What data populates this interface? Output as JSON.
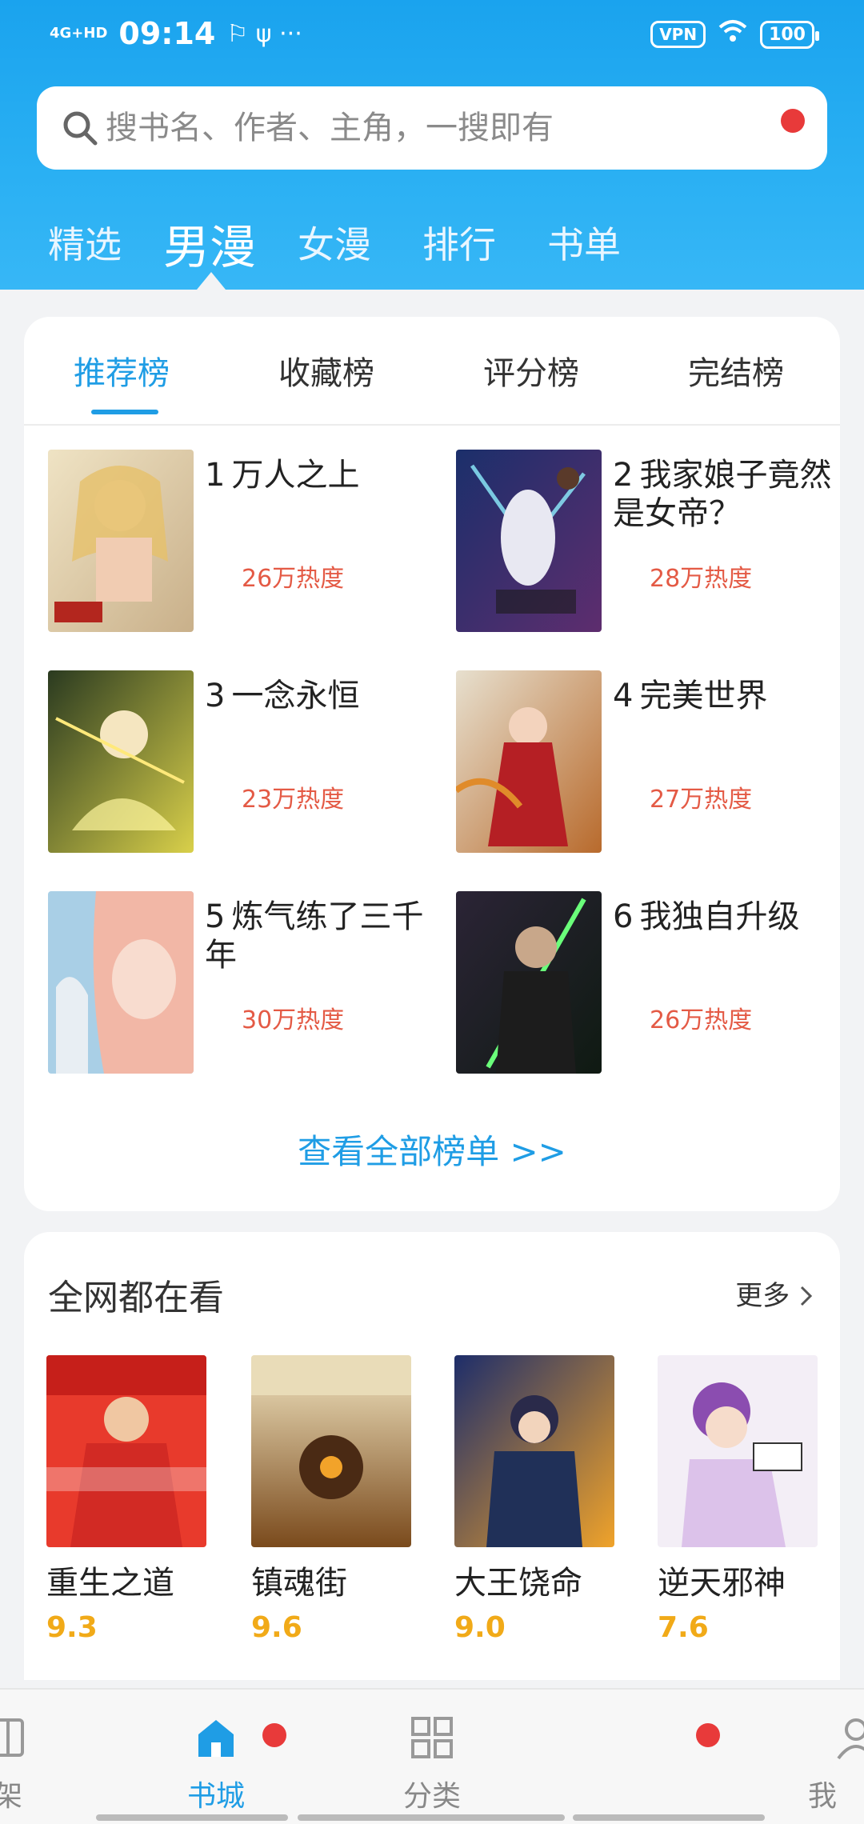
{
  "status_bar": {
    "signal": "4G+HD",
    "time": "09:14",
    "vpn": "VPN",
    "battery": "100"
  },
  "search": {
    "placeholder": "搜书名、作者、主角，一搜即有"
  },
  "top_tabs": [
    "精选",
    "男漫",
    "女漫",
    "排行",
    "书单"
  ],
  "rank_tabs": [
    "推荐榜",
    "收藏榜",
    "评分榜",
    "完结榜"
  ],
  "rank_items": [
    {
      "num": "1",
      "title": "万人之上",
      "heat": "26万热度"
    },
    {
      "num": "2",
      "title": "我家娘子竟然是女帝？",
      "heat": "28万热度"
    },
    {
      "num": "3",
      "title": "一念永恒",
      "heat": "23万热度"
    },
    {
      "num": "4",
      "title": "完美世界",
      "heat": "27万热度"
    },
    {
      "num": "5",
      "title": "炼气练了三千年",
      "heat": "30万热度"
    },
    {
      "num": "6",
      "title": "我独自升级",
      "heat": "26万热度"
    }
  ],
  "view_all": "查看全部榜单 >>",
  "hot_section": {
    "title": "全网都在看",
    "more": "更多",
    "items": [
      {
        "name": "重生之道",
        "score": "9.3"
      },
      {
        "name": "镇魂街",
        "score": "9.6"
      },
      {
        "name": "大王饶命",
        "score": "9.0"
      },
      {
        "name": "逆天邪神",
        "score": "7.6"
      }
    ]
  },
  "bottom_nav": {
    "bookshelf": "架",
    "bookstore": "书城",
    "category": "分类",
    "mine": "我"
  },
  "colors": {
    "accent": "#1f9de5",
    "header_blue": "#1aa3ee",
    "heat_red": "#e45a45",
    "score_orange": "#f1aa18",
    "badge_red": "#e83a3a"
  }
}
